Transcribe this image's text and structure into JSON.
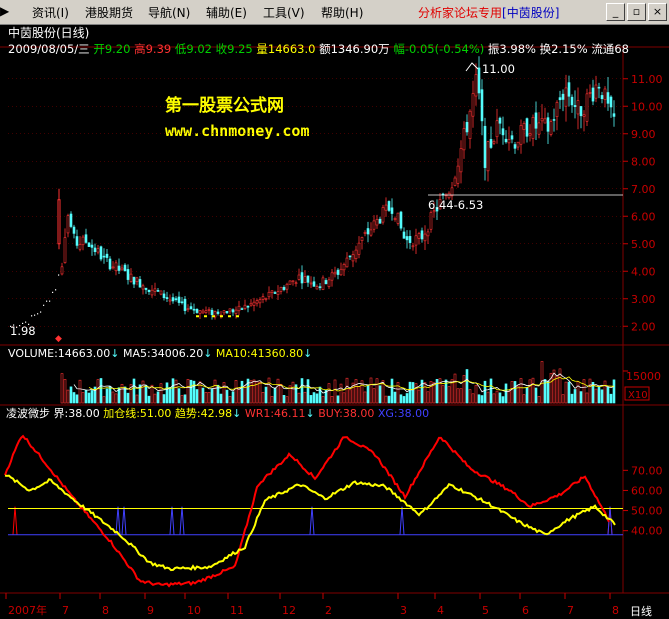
{
  "menu": {
    "items": [
      "资讯(I)",
      "港股期货",
      "导航(N)",
      "辅助(E)",
      "工具(V)",
      "帮助(H)"
    ],
    "brand_text": "分析家论坛专用",
    "brand_stock": "[中茵股份]"
  },
  "window_controls": {
    "minimize": "_",
    "restore": "▫",
    "close": "×"
  },
  "header": {
    "title": "中茵股份(日线)",
    "date": "2009/08/05/三",
    "open_label": "开",
    "open": "9.20",
    "high_label": "高",
    "high": "9.39",
    "low_label": "低",
    "low": "9.02",
    "close_label": "收",
    "close": "9.25",
    "vol_label": "量",
    "vol": "14663.0",
    "amount_label": "额",
    "amount": "1346.90万",
    "change_label": "幅",
    "change": "-0.05(-0.54%)",
    "amp_label": "振",
    "amp": "3.98%",
    "turnover_label": "换",
    "turnover": "2.15%",
    "float_label": "流通",
    "float": "68"
  },
  "watermark": {
    "line1": "第一股票公式网",
    "line2": "www.chnmoney.com"
  },
  "price_annotations": {
    "high": "11.00",
    "support": "6.44-6.53",
    "low": "1.98"
  },
  "volume_header": {
    "vol": "VOLUME:14663.00",
    "ma5": "MA5:34006.20",
    "ma10": "MA10:41360.80"
  },
  "volume_axis": {
    "top": "15000",
    "unit": "X10"
  },
  "indicator_header": {
    "name": "凌波微步",
    "jie": "界:38.00",
    "jiacang": "加仓线:51.00",
    "qushi": "趋势:42.98",
    "wr1": "WR1:46.11",
    "buy": "BUY:38.00",
    "xg": "XG:38.00"
  },
  "time_axis": {
    "labels": [
      "2007年",
      "7",
      "8",
      "9",
      "10",
      "11",
      "12",
      "2",
      "3",
      "4",
      "5",
      "6",
      "7",
      "8"
    ],
    "period": "日线"
  },
  "colors": {
    "up": "#ff3232",
    "down": "#54fcfc",
    "yellow": "#ffff00",
    "red": "#ff0000",
    "blue": "#4040ff",
    "magenta": "#ff00ff",
    "grid": "#800000",
    "axis_text": "#c80000"
  },
  "chart_data": [
    {
      "type": "candlestick",
      "ylim": [
        1.5,
        11.5
      ],
      "y_ticks": [
        2,
        3,
        4,
        5,
        6,
        7,
        8,
        9,
        10,
        11
      ],
      "anchors": [
        [
          0,
          2.0
        ],
        [
          20,
          2.2
        ],
        [
          35,
          2.7
        ],
        [
          48,
          3.5
        ],
        [
          53,
          4.3
        ],
        [
          58,
          6.2
        ],
        [
          66,
          5.0
        ],
        [
          78,
          5.1
        ],
        [
          96,
          4.4
        ],
        [
          120,
          3.8
        ],
        [
          150,
          3.2
        ],
        [
          175,
          2.7
        ],
        [
          200,
          2.5
        ],
        [
          230,
          2.6
        ],
        [
          260,
          3.1
        ],
        [
          290,
          3.8
        ],
        [
          310,
          3.5
        ],
        [
          330,
          4.0
        ],
        [
          350,
          5.0
        ],
        [
          372,
          6.0
        ],
        [
          384,
          6.4
        ],
        [
          396,
          5.1
        ],
        [
          412,
          5.2
        ],
        [
          428,
          6.3
        ],
        [
          442,
          7.1
        ],
        [
          456,
          9.0
        ],
        [
          468,
          11.0
        ],
        [
          476,
          8.1
        ],
        [
          490,
          9.4
        ],
        [
          505,
          8.7
        ],
        [
          520,
          9.3
        ],
        [
          540,
          9.2
        ],
        [
          556,
          10.7
        ],
        [
          570,
          9.8
        ],
        [
          590,
          10.9
        ],
        [
          602,
          9.6
        ],
        [
          612,
          9.25
        ]
      ]
    },
    {
      "type": "bar",
      "series": [
        {
          "name": "VOLUME"
        },
        {
          "name": "MA5"
        },
        {
          "name": "MA10"
        }
      ]
    },
    {
      "type": "line",
      "ylim": [
        10,
        100
      ],
      "y_ticks": [
        40,
        50,
        60,
        70
      ],
      "series": [
        {
          "name": "WR1",
          "color": "#ff0000",
          "points": [
            [
              5,
              68
            ],
            [
              22,
              88
            ],
            [
              45,
              74
            ],
            [
              75,
              55
            ],
            [
              110,
              35
            ],
            [
              140,
              15
            ],
            [
              160,
              13
            ],
            [
              195,
              14
            ],
            [
              235,
              22
            ],
            [
              258,
              63
            ],
            [
              290,
              78
            ],
            [
              315,
              66
            ],
            [
              345,
              87
            ],
            [
              375,
              78
            ],
            [
              405,
              57
            ],
            [
              440,
              87
            ],
            [
              470,
              71
            ],
            [
              510,
              60
            ],
            [
              530,
              52
            ],
            [
              560,
              58
            ],
            [
              585,
              67
            ],
            [
              610,
              44
            ]
          ]
        },
        {
          "name": "趋势",
          "color": "#ffff00",
          "points": [
            [
              5,
              68
            ],
            [
              30,
              60
            ],
            [
              50,
              65
            ],
            [
              80,
              53
            ],
            [
              120,
              38
            ],
            [
              150,
              24
            ],
            [
              170,
              21
            ],
            [
              210,
              22
            ],
            [
              245,
              32
            ],
            [
              265,
              55
            ],
            [
              300,
              63
            ],
            [
              325,
              56
            ],
            [
              355,
              64
            ],
            [
              385,
              62
            ],
            [
              420,
              48
            ],
            [
              450,
              63
            ],
            [
              490,
              53
            ],
            [
              520,
              44
            ],
            [
              545,
              38
            ],
            [
              570,
              46
            ],
            [
              595,
              52
            ],
            [
              615,
              43
            ]
          ]
        },
        {
          "name": "加仓线",
          "color": "#ffff00",
          "level": 51
        },
        {
          "name": "界",
          "color": "#4040ff",
          "level": 38
        }
      ],
      "buy_signals_red": [
        15,
        610
      ],
      "buy_signals_blue": [
        118,
        124,
        172,
        182,
        312,
        402,
        610
      ]
    }
  ]
}
